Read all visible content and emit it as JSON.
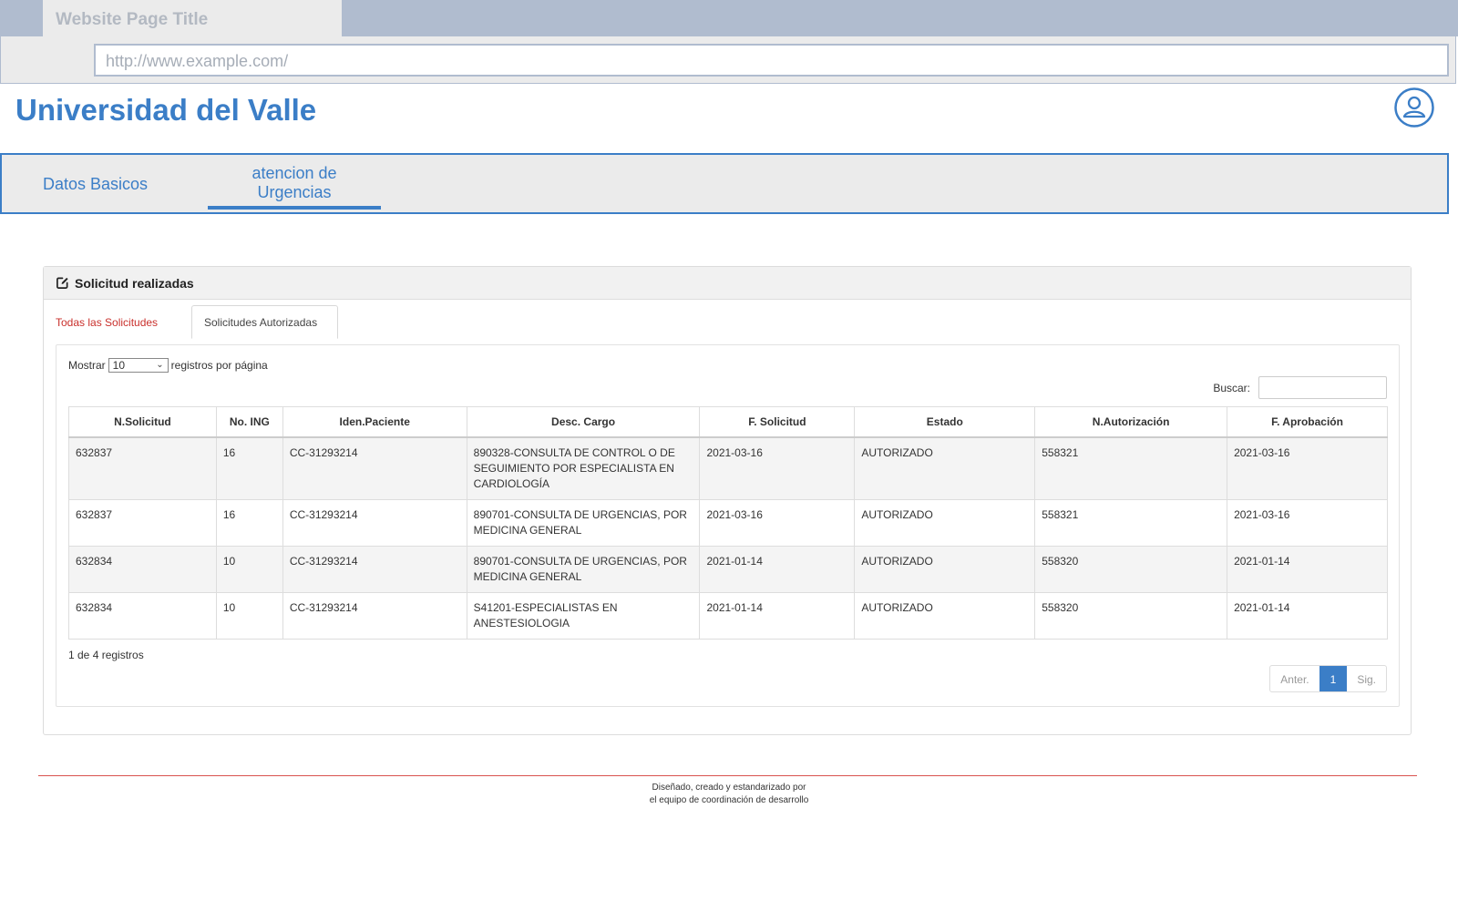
{
  "browser": {
    "tab_title": "Website Page Title",
    "url": "http://www.example.com/"
  },
  "header": {
    "title": "Universidad del Valle",
    "user_icon": "user-icon"
  },
  "nav": {
    "items": [
      {
        "label": "Datos Basicos"
      },
      {
        "label_line1": "atencion de",
        "label_line2": "Urgencias",
        "active": true
      }
    ]
  },
  "panel": {
    "title": "Solicitud realizadas",
    "title_icon": "edit-icon",
    "tabs": [
      {
        "label": "Todas las Solicitudes"
      },
      {
        "label": "Solicitudes Autorizadas",
        "active": true
      }
    ],
    "show_prefix": "Mostrar",
    "show_value": "10",
    "show_suffix": "registros por página",
    "search_label": "Buscar:",
    "search_value": "",
    "columns": [
      "N.Solicitud",
      "No. ING",
      "Iden.Paciente",
      "Desc. Cargo",
      "F. Solicitud",
      "Estado",
      "N.Autorización",
      "F. Aprobación"
    ],
    "rows": [
      [
        "632837",
        "16",
        "CC-31293214",
        "890328-CONSULTA DE CONTROL O DE SEGUIMIENTO POR ESPECIALISTA EN CARDIOLOGÍA",
        "2021-03-16",
        "AUTORIZADO",
        "558321",
        "2021-03-16"
      ],
      [
        "632837",
        "16",
        "CC-31293214",
        "890701-CONSULTA DE URGENCIAS, POR MEDICINA GENERAL",
        "2021-03-16",
        "AUTORIZADO",
        "558321",
        "2021-03-16"
      ],
      [
        "632834",
        "10",
        "CC-31293214",
        "890701-CONSULTA DE URGENCIAS, POR MEDICINA GENERAL",
        "2021-01-14",
        "AUTORIZADO",
        "558320",
        "2021-01-14"
      ],
      [
        "632834",
        "10",
        "CC-31293214",
        "S41201-ESPECIALISTAS EN ANESTESIOLOGIA",
        "2021-01-14",
        "AUTORIZADO",
        "558320",
        "2021-01-14"
      ]
    ],
    "info": "1 de 4 registros",
    "pager": {
      "prev": "Anter.",
      "current": "1",
      "next": "Sig."
    }
  },
  "footer": {
    "line1": "Diseñado, creado y estandarizado por",
    "line2": "el equipo de coordinación de desarrollo"
  },
  "colors": {
    "accent": "#3b7ec7",
    "tab_red": "#c9302c",
    "chrome": "#b0bccf"
  }
}
